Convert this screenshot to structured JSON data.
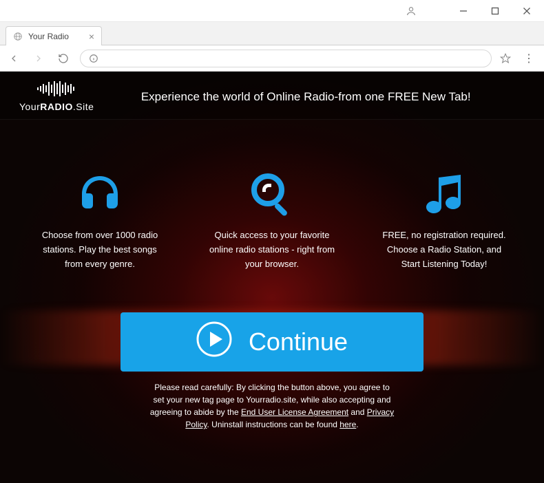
{
  "window": {
    "tab_title": "Your Radio"
  },
  "page": {
    "logo": {
      "prefix": "Your",
      "strong": "RADIO",
      "suffix": ".Site"
    },
    "tagline": "Experience the world of Online Radio-from one FREE New Tab!",
    "features": [
      {
        "icon": "headphones-icon",
        "text": "Choose from over 1000 radio stations. Play the best songs from every genre."
      },
      {
        "icon": "search-icon",
        "text": "Quick access to your favorite online radio stations - right from your browser."
      },
      {
        "icon": "music-icon",
        "text": "FREE, no registration required. Choose a Radio Station, and Start Listening Today!"
      }
    ],
    "cta_label": "Continue",
    "disclaimer": {
      "pre": "Please read carefully: By clicking the button above, you agree to set your new tag page to Yourradio.site, while also accepting and agreeing to abide by the ",
      "link1": "End User License Agreement",
      "mid": " and ",
      "link2": "Privacy Policy",
      "post1": ". Uninstall instructions can be found ",
      "link3": "here",
      "post2": "."
    }
  },
  "icons": {
    "user": "user-icon",
    "minimize": "minimize-icon",
    "maximize": "maximize-icon",
    "close": "close-icon",
    "back": "back-icon",
    "forward": "forward-icon",
    "reload": "reload-icon",
    "info": "info-icon",
    "star": "star-icon",
    "menu": "menu-icon",
    "tab_favicon": "globe-icon",
    "tab_close": "close-icon",
    "play": "play-icon"
  }
}
